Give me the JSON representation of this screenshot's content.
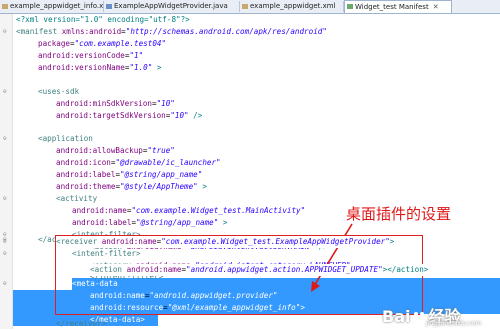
{
  "tabs": [
    {
      "label": "example_appwidget_info.xml"
    },
    {
      "label": "ExampleAppWidgetProvider.java"
    },
    {
      "label": "example_appwidget.xml"
    },
    {
      "label": "Widget_test Manifest"
    }
  ],
  "close_glyph": "✕",
  "code": {
    "l1_decl": "<?xml version=\"1.0\" encoding=\"utf-8\"?>",
    "l2_tag": "<manifest",
    "l2_attr": "xmlns:android",
    "l2_val": "\"http://schemas.android.com/apk/res/android\"",
    "l3_attr": "package",
    "l3_val": "\"com.example.test04\"",
    "l4_attr": "android:versionCode",
    "l4_val": "\"1\"",
    "l5_attr": "android:versionName",
    "l5_val": "\"1.0\"",
    "l5_end": " >",
    "l7_tag": "<uses-sdk",
    "l8_attr": "android:minSdkVersion",
    "l8_val": "\"10\"",
    "l9_attr": "android:targetSdkVersion",
    "l9_val": "\"10\"",
    "l9_end": " />",
    "l11_tag": "<application",
    "l12_attr": "android:allowBackup",
    "l12_val": "\"true\"",
    "l13_attr": "android:icon",
    "l13_val": "\"@drawable/ic_launcher\"",
    "l14_attr": "android:label",
    "l14_val": "\"@string/app_name\"",
    "l15_attr": "android:theme",
    "l15_val": "\"@style/AppTheme\"",
    "l15_end": " >",
    "l16_tag": "<activity",
    "l17_attr": "android:name",
    "l17_val": "\"com.example.Widget_test.MainActivity\"",
    "l18_attr": "android:label",
    "l18_val": "\"@string/app_name\"",
    "l18_end": " >",
    "l19_tag": "<intent-filter>",
    "l20_tag": "<action",
    "l20_attr": "android:name",
    "l20_val": "\"android.intent.action.MAIN\"",
    "l20_end": " />",
    "l22_tag": "<category",
    "l22_attr": "android:name",
    "l22_val": "\"android.intent.category.LAUNCHER\"",
    "l23_tag": "</intent-filter>",
    "l24_tag": "</activity>",
    "l25_tag": "<receiver",
    "l25_attr": "android:name",
    "l25_val": "\"com.example.Widget_test.ExampleAppWidgetProvider\"",
    "l25_end": ">",
    "l26_tag": "<intent-filter>",
    "l28_tag": "<action",
    "l28_attr": "android:name",
    "l28_val": "\"android.appwidget.action.APPWIDGET_UPDATE\"",
    "l28_end": "></action>",
    "l29_tag": "</intent-filter>",
    "l30_tag": "<meta-data",
    "l31_attr": "android:name",
    "l31_val": "\"android.appwidget.provider\"",
    "l32_attr": "android:resource",
    "l32_val": "\"@xml/example_appwidget_info\"",
    "l32_end": ">",
    "l33_tag": "</meta-data>",
    "l34_tag": "</receiver>"
  },
  "annotation": "桌面插件的设置",
  "watermark": {
    "text1": "Bai",
    "text2": "经验",
    "sub": "jingyan.baidu.com"
  },
  "colors": {
    "selection": "#3399ff",
    "annotation": "#e01818",
    "tag": "#3f7f7f",
    "attr": "#7f007f",
    "value": "#2a00ff"
  }
}
